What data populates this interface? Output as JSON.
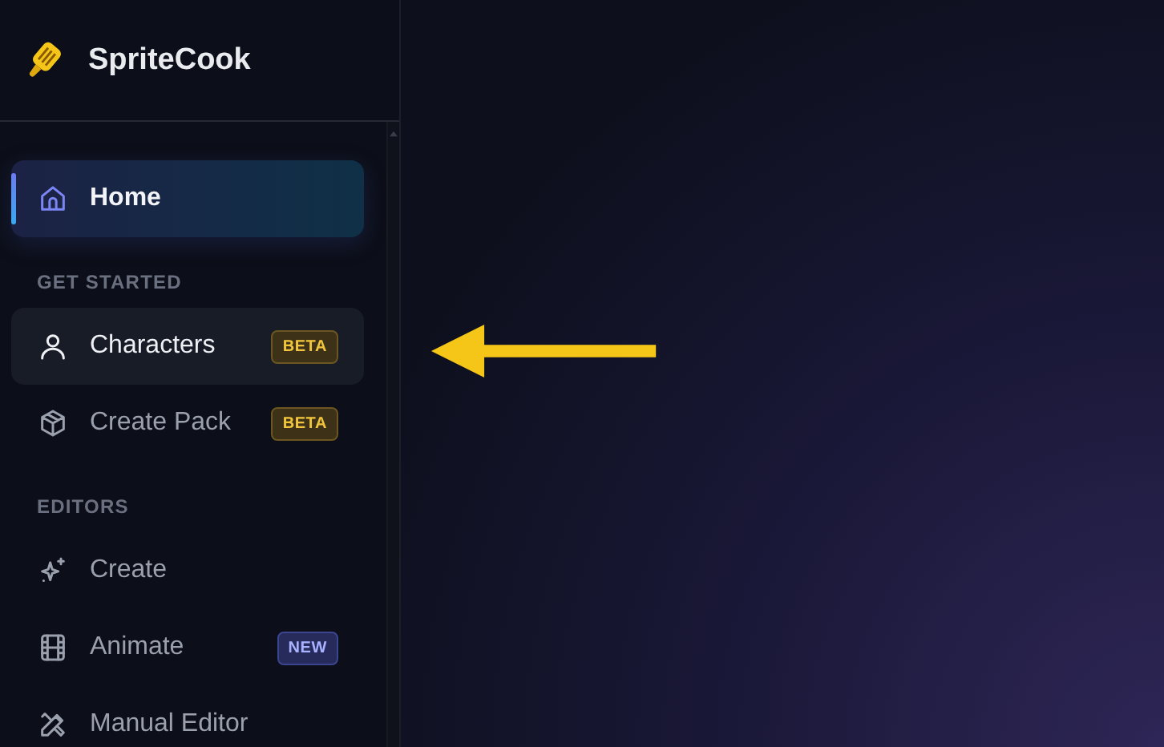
{
  "app": {
    "name": "SpriteCook"
  },
  "sidebar": {
    "items": [
      {
        "label": "Home",
        "selected": true
      }
    ],
    "sections": [
      {
        "title": "GET STARTED",
        "items": [
          {
            "label": "Characters",
            "selected": false,
            "hovered": true,
            "badge": {
              "label": "BETA",
              "kind": "beta"
            }
          },
          {
            "label": "Create Pack",
            "selected": false,
            "hovered": false,
            "badge": {
              "label": "BETA",
              "kind": "beta"
            }
          }
        ]
      },
      {
        "title": "EDITORS",
        "items": [
          {
            "label": "Create",
            "selected": false,
            "hovered": false
          },
          {
            "label": "Animate",
            "selected": false,
            "hovered": false,
            "badge": {
              "label": "NEW",
              "kind": "new"
            }
          },
          {
            "label": "Manual Editor",
            "selected": false,
            "hovered": false
          }
        ]
      }
    ]
  }
}
